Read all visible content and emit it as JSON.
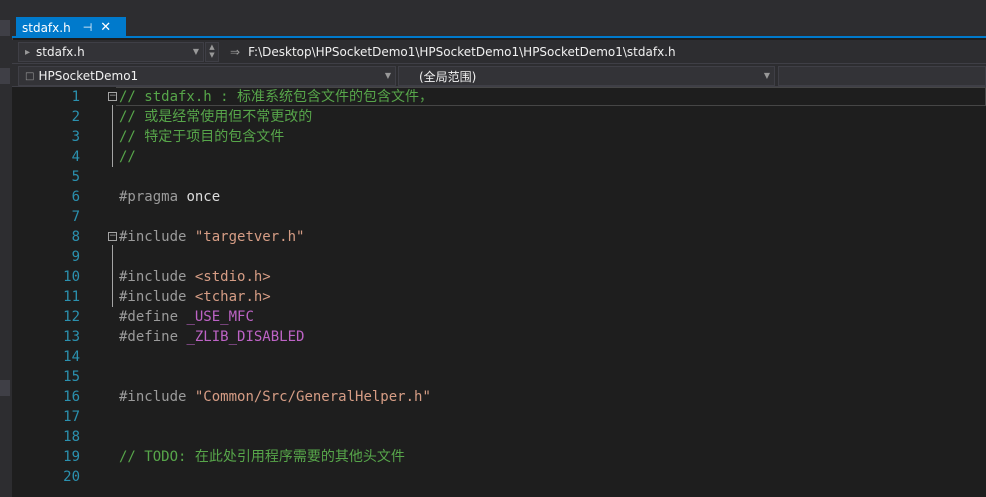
{
  "tab": {
    "title": "stdafx.h",
    "pin_icon": "pin-icon",
    "close_icon": "close-icon"
  },
  "navbar": {
    "file_combo": "stdafx.h",
    "path": "F:\\Desktop\\HPSocketDemo1\\HPSocketDemo1\\HPSocketDemo1\\stdafx.h"
  },
  "scopebar": {
    "project": "HPSocketDemo1",
    "scope": "(全局范围)",
    "member": ""
  },
  "lines": [
    {
      "no": "1",
      "parts": [
        {
          "t": "// stdafx.h : 标准系统包含文件的包含文件，",
          "c": "c-comment"
        }
      ]
    },
    {
      "no": "2",
      "parts": [
        {
          "t": "// 或是经常使用但不常更改的",
          "c": "c-comment"
        }
      ]
    },
    {
      "no": "3",
      "parts": [
        {
          "t": "// 特定于项目的包含文件",
          "c": "c-comment"
        }
      ]
    },
    {
      "no": "4",
      "parts": [
        {
          "t": "//",
          "c": "c-comment"
        }
      ]
    },
    {
      "no": "5",
      "parts": []
    },
    {
      "no": "6",
      "parts": [
        {
          "t": "#pragma",
          "c": "c-pp"
        },
        {
          "t": " once",
          "c": "c-plain"
        }
      ]
    },
    {
      "no": "7",
      "parts": []
    },
    {
      "no": "8",
      "parts": [
        {
          "t": "#include",
          "c": "c-pp"
        },
        {
          "t": " ",
          "c": "c-plain"
        },
        {
          "t": "\"targetver.h\"",
          "c": "c-str"
        }
      ]
    },
    {
      "no": "9",
      "parts": []
    },
    {
      "no": "10",
      "parts": [
        {
          "t": "#include",
          "c": "c-pp"
        },
        {
          "t": " ",
          "c": "c-plain"
        },
        {
          "t": "<stdio.h>",
          "c": "c-str"
        }
      ]
    },
    {
      "no": "11",
      "parts": [
        {
          "t": "#include",
          "c": "c-pp"
        },
        {
          "t": " ",
          "c": "c-plain"
        },
        {
          "t": "<tchar.h>",
          "c": "c-str"
        }
      ]
    },
    {
      "no": "12",
      "parts": [
        {
          "t": "#define",
          "c": "c-pp"
        },
        {
          "t": " ",
          "c": "c-plain"
        },
        {
          "t": "_USE_MFC",
          "c": "c-macro"
        }
      ]
    },
    {
      "no": "13",
      "parts": [
        {
          "t": "#define",
          "c": "c-pp"
        },
        {
          "t": " ",
          "c": "c-plain"
        },
        {
          "t": "_ZLIB_DISABLED",
          "c": "c-macro"
        }
      ]
    },
    {
      "no": "14",
      "parts": []
    },
    {
      "no": "15",
      "parts": []
    },
    {
      "no": "16",
      "parts": [
        {
          "t": "#include",
          "c": "c-pp"
        },
        {
          "t": " ",
          "c": "c-plain"
        },
        {
          "t": "\"Common/Src/GeneralHelper.h\"",
          "c": "c-str"
        }
      ]
    },
    {
      "no": "17",
      "parts": []
    },
    {
      "no": "18",
      "parts": []
    },
    {
      "no": "19",
      "parts": [
        {
          "t": "// TODO: 在此处引用程序需要的其他头文件",
          "c": "c-comment"
        }
      ]
    },
    {
      "no": "20",
      "parts": []
    }
  ],
  "colors": {
    "accent": "#007acc",
    "comment": "#57a64a",
    "preprocessor": "#9b9b9b",
    "string": "#d69d85",
    "macro": "#bd63c5",
    "line_number": "#2b91af"
  }
}
